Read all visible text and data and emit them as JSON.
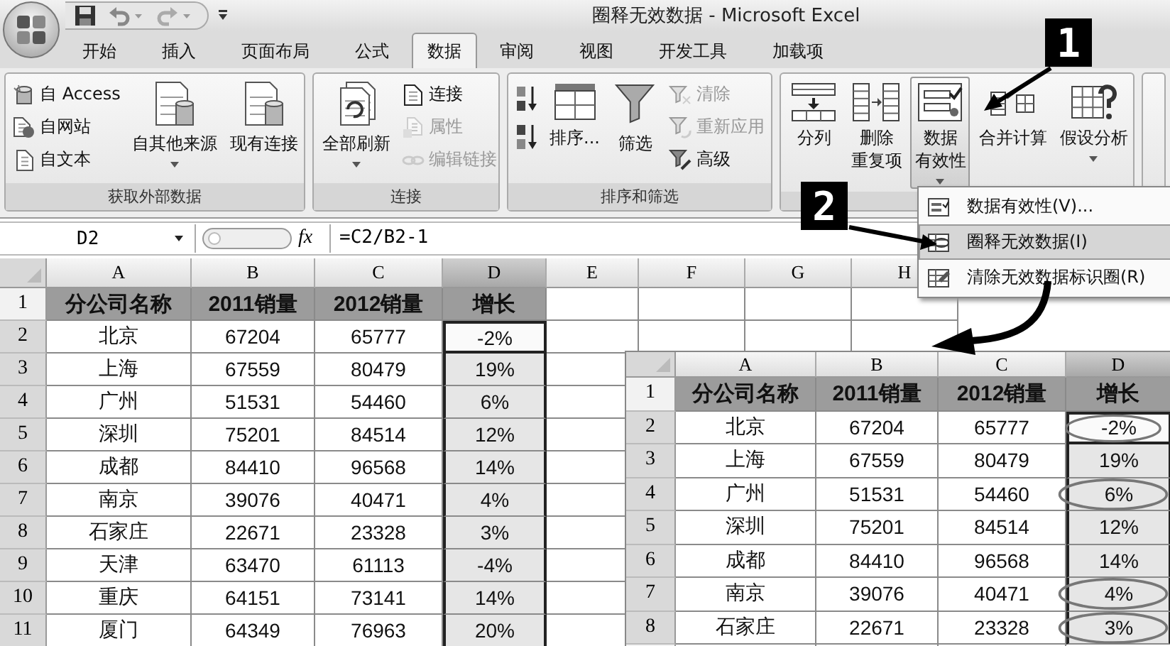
{
  "window": {
    "title": "圈释无效数据 - Microsoft Excel"
  },
  "tabs": [
    {
      "label": "开始",
      "selected": false
    },
    {
      "label": "插入",
      "selected": false
    },
    {
      "label": "页面布局",
      "selected": false
    },
    {
      "label": "公式",
      "selected": false
    },
    {
      "label": "数据",
      "selected": true
    },
    {
      "label": "审阅",
      "selected": false
    },
    {
      "label": "视图",
      "selected": false
    },
    {
      "label": "开发工具",
      "selected": false
    },
    {
      "label": "加载项",
      "selected": false
    }
  ],
  "ribbon": {
    "groups": [
      {
        "label": "获取外部数据",
        "items": [
          {
            "kind": "small",
            "lines": [
              "自 Access"
            ],
            "disabled": false,
            "menu": false,
            "pressed": false
          },
          {
            "kind": "small",
            "lines": [
              "自网站"
            ],
            "disabled": false,
            "menu": false,
            "pressed": false
          },
          {
            "kind": "small",
            "lines": [
              "自文本"
            ],
            "disabled": false,
            "menu": false,
            "pressed": false
          },
          {
            "kind": "large",
            "lines": [
              "自其他来源"
            ],
            "disabled": false,
            "menu": true,
            "pressed": false
          },
          {
            "kind": "large",
            "lines": [
              "现有连接"
            ],
            "disabled": false,
            "menu": false,
            "pressed": false
          }
        ]
      },
      {
        "label": "连接",
        "items": [
          {
            "kind": "large",
            "lines": [
              "全部刷新"
            ],
            "disabled": false,
            "menu": true,
            "pressed": false
          },
          {
            "kind": "small",
            "lines": [
              "连接"
            ],
            "disabled": false,
            "menu": false,
            "pressed": false
          },
          {
            "kind": "small",
            "lines": [
              "属性"
            ],
            "disabled": true,
            "menu": false,
            "pressed": false
          },
          {
            "kind": "small",
            "lines": [
              "编辑链接"
            ],
            "disabled": true,
            "menu": false,
            "pressed": false
          }
        ]
      },
      {
        "label": "排序和筛选",
        "items": [
          {
            "kind": "icon",
            "disabled": false,
            "menu": false,
            "pressed": false
          },
          {
            "kind": "icon",
            "disabled": false,
            "menu": false,
            "pressed": false
          },
          {
            "kind": "large",
            "lines": [
              "排序..."
            ],
            "disabled": false,
            "menu": false,
            "pressed": false
          },
          {
            "kind": "large",
            "lines": [
              "筛选"
            ],
            "disabled": false,
            "menu": false,
            "pressed": false
          },
          {
            "kind": "small",
            "lines": [
              "清除"
            ],
            "disabled": true,
            "menu": false,
            "pressed": false
          },
          {
            "kind": "small",
            "lines": [
              "重新应用"
            ],
            "disabled": true,
            "menu": false,
            "pressed": false
          },
          {
            "kind": "small",
            "lines": [
              "高级"
            ],
            "disabled": false,
            "menu": false,
            "pressed": false
          }
        ]
      },
      {
        "items": [
          {
            "kind": "large",
            "lines": [
              "分列"
            ],
            "disabled": false,
            "menu": false,
            "pressed": false
          },
          {
            "kind": "large",
            "lines": [
              "删除",
              "重复项"
            ],
            "disabled": false,
            "menu": false,
            "pressed": false
          },
          {
            "kind": "large",
            "lines": [
              "数据",
              "有效性"
            ],
            "disabled": false,
            "menu": true,
            "pressed": true
          },
          {
            "kind": "large",
            "lines": [
              "合并计算"
            ],
            "disabled": false,
            "menu": false,
            "pressed": false
          },
          {
            "kind": "large",
            "lines": [
              "假设分析"
            ],
            "disabled": false,
            "menu": true,
            "pressed": false
          }
        ]
      }
    ]
  },
  "formula_bar": {
    "name_box": "D2",
    "function_label": "fx",
    "formula": "=C2/B2-1"
  },
  "sheet": {
    "columns": [
      {
        "label": "A",
        "selected": false
      },
      {
        "label": "B",
        "selected": false
      },
      {
        "label": "C",
        "selected": false
      },
      {
        "label": "D",
        "selected": true
      },
      {
        "label": "E",
        "selected": false
      },
      {
        "label": "F",
        "selected": false
      },
      {
        "label": "G",
        "selected": false
      },
      {
        "label": "H",
        "selected": false
      }
    ],
    "rows": [
      {
        "number": "1",
        "kind": "header",
        "selected": false,
        "active": false,
        "cells": [
          "分公司名称",
          "2011销量",
          "2012销量",
          "增长"
        ]
      },
      {
        "number": "2",
        "kind": "data",
        "selected": true,
        "active": true,
        "cells": [
          "北京",
          "67204",
          "65777",
          "-2%"
        ]
      },
      {
        "number": "3",
        "kind": "data",
        "selected": true,
        "active": false,
        "cells": [
          "上海",
          "67559",
          "80479",
          "19%"
        ]
      },
      {
        "number": "4",
        "kind": "data",
        "selected": true,
        "active": false,
        "cells": [
          "广州",
          "51531",
          "54460",
          "6%"
        ]
      },
      {
        "number": "5",
        "kind": "data",
        "selected": true,
        "active": false,
        "cells": [
          "深圳",
          "75201",
          "84514",
          "12%"
        ]
      },
      {
        "number": "6",
        "kind": "data",
        "selected": true,
        "active": false,
        "cells": [
          "成都",
          "84410",
          "96568",
          "14%"
        ]
      },
      {
        "number": "7",
        "kind": "data",
        "selected": true,
        "active": false,
        "cells": [
          "南京",
          "39076",
          "40471",
          "4%"
        ]
      },
      {
        "number": "8",
        "kind": "data",
        "selected": true,
        "active": false,
        "cells": [
          "石家庄",
          "22671",
          "23328",
          "3%"
        ]
      },
      {
        "number": "9",
        "kind": "data",
        "selected": true,
        "active": false,
        "cells": [
          "天津",
          "63470",
          "61113",
          "-4%"
        ]
      },
      {
        "number": "10",
        "kind": "data",
        "selected": true,
        "active": false,
        "cells": [
          "重庆",
          "64151",
          "73141",
          "14%"
        ]
      },
      {
        "number": "11",
        "kind": "data",
        "selected": true,
        "active": false,
        "cells": [
          "厦门",
          "64349",
          "76963",
          "20%"
        ]
      }
    ]
  },
  "result_sheet": {
    "columns": [
      {
        "label": "A",
        "selected": false
      },
      {
        "label": "B",
        "selected": false
      },
      {
        "label": "C",
        "selected": false
      },
      {
        "label": "D",
        "selected": true
      }
    ],
    "rows": [
      {
        "number": "1",
        "kind": "header",
        "selected": false,
        "active": false,
        "circled": false,
        "cells": [
          "分公司名称",
          "2011销量",
          "2012销量",
          "增长"
        ]
      },
      {
        "number": "2",
        "kind": "data",
        "selected": true,
        "active": true,
        "circled": true,
        "cells": [
          "北京",
          "67204",
          "65777",
          "-2%"
        ]
      },
      {
        "number": "3",
        "kind": "data",
        "selected": true,
        "active": false,
        "circled": false,
        "cells": [
          "上海",
          "67559",
          "80479",
          "19%"
        ]
      },
      {
        "number": "4",
        "kind": "data",
        "selected": true,
        "active": false,
        "circled": true,
        "cells": [
          "广州",
          "51531",
          "54460",
          "6%"
        ]
      },
      {
        "number": "5",
        "kind": "data",
        "selected": true,
        "active": false,
        "circled": false,
        "cells": [
          "深圳",
          "75201",
          "84514",
          "12%"
        ]
      },
      {
        "number": "6",
        "kind": "data",
        "selected": true,
        "active": false,
        "circled": false,
        "cells": [
          "成都",
          "84410",
          "96568",
          "14%"
        ]
      },
      {
        "number": "7",
        "kind": "data",
        "selected": true,
        "active": false,
        "circled": true,
        "cells": [
          "南京",
          "39076",
          "40471",
          "4%"
        ]
      },
      {
        "number": "8",
        "kind": "data",
        "selected": true,
        "active": false,
        "circled": true,
        "cells": [
          "石家庄",
          "22671",
          "23328",
          "3%"
        ]
      }
    ]
  },
  "validation_menu": {
    "items": [
      {
        "label": "数据有效性(V)...",
        "selected": false
      },
      {
        "label": "圈释无效数据(I)",
        "selected": true
      },
      {
        "label": "清除无效数据标识圈(R)",
        "selected": false
      }
    ]
  },
  "callouts": [
    {
      "label": "1"
    },
    {
      "label": "2"
    }
  ]
}
